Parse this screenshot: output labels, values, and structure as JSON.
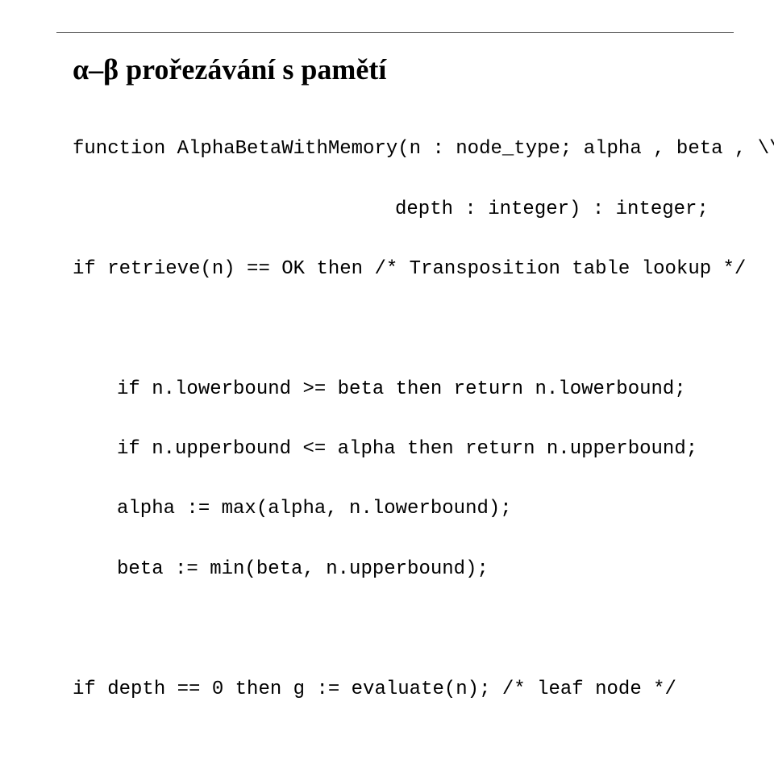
{
  "title_prefix": "α–β ",
  "title_rest": "prořezávání s pamětí",
  "code": {
    "l1": "function AlphaBetaWithMemory(n : node_type; alpha , beta , \\\\",
    "l2": "depth : integer) : integer;",
    "l3": "if retrieve(n) == OK then /* Transposition table lookup */",
    "blank1": " ",
    "l4": "if n.lowerbound >= beta then return n.lowerbound;",
    "l5": "if n.upperbound <= alpha then return n.upperbound;",
    "l6": "alpha := max(alpha, n.lowerbound);",
    "l7": "beta := min(beta, n.upperbound);",
    "blank2": " ",
    "l8": "if depth == 0 then g := evaluate(n); /* leaf node */"
  }
}
